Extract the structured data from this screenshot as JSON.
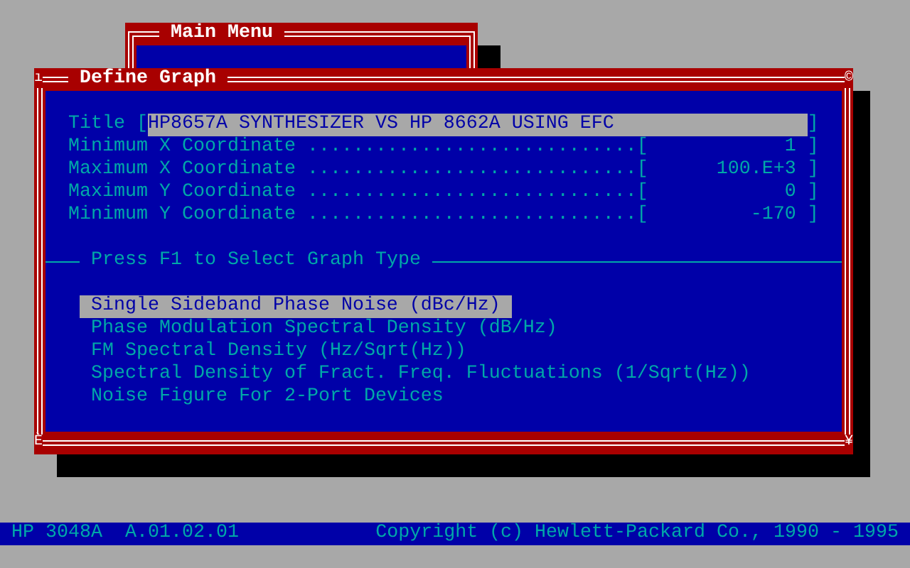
{
  "background_window": {
    "title": "Main Menu"
  },
  "window": {
    "title": "Define Graph",
    "corner_marks": [
      "ı",
      "©",
      "È",
      "¥"
    ]
  },
  "fields": [
    {
      "kind": "text",
      "label": "Title",
      "leader": "[",
      "value": "HP8657A SYNTHESIZER VS HP 8662A USING EFC",
      "close": "]"
    },
    {
      "kind": "number",
      "label": "Minimum X Coordinate",
      "leader": ".............................[",
      "value": "1",
      "close": "]"
    },
    {
      "kind": "number",
      "label": "Maximum X Coordinate",
      "leader": ".............................[",
      "value": "100.E+3",
      "close": "]"
    },
    {
      "kind": "number",
      "label": "Maximum Y Coordinate",
      "leader": ".............................[",
      "value": "0",
      "close": "]"
    },
    {
      "kind": "number",
      "label": "Minimum Y Coordinate",
      "leader": ".............................[",
      "value": "-170",
      "close": "]"
    }
  ],
  "section_heading": "Press F1 to Select Graph Type",
  "graph_types": [
    {
      "label": "Single Sideband Phase Noise (dBc/Hz)",
      "selected": true
    },
    {
      "label": "Phase Modulation Spectral Density (dB/Hz)",
      "selected": false
    },
    {
      "label": "FM Spectral Density (Hz/Sqrt(Hz))",
      "selected": false
    },
    {
      "label": "Spectral Density of Fract. Freq. Fluctuations (1/Sqrt(Hz))",
      "selected": false
    },
    {
      "label": "Noise Figure For 2-Port Devices",
      "selected": false
    }
  ],
  "status_bar": {
    "left": "HP 3048A  A.01.02.01",
    "right": "Copyright (c) Hewlett-Packard Co., 1990 - 1995"
  }
}
